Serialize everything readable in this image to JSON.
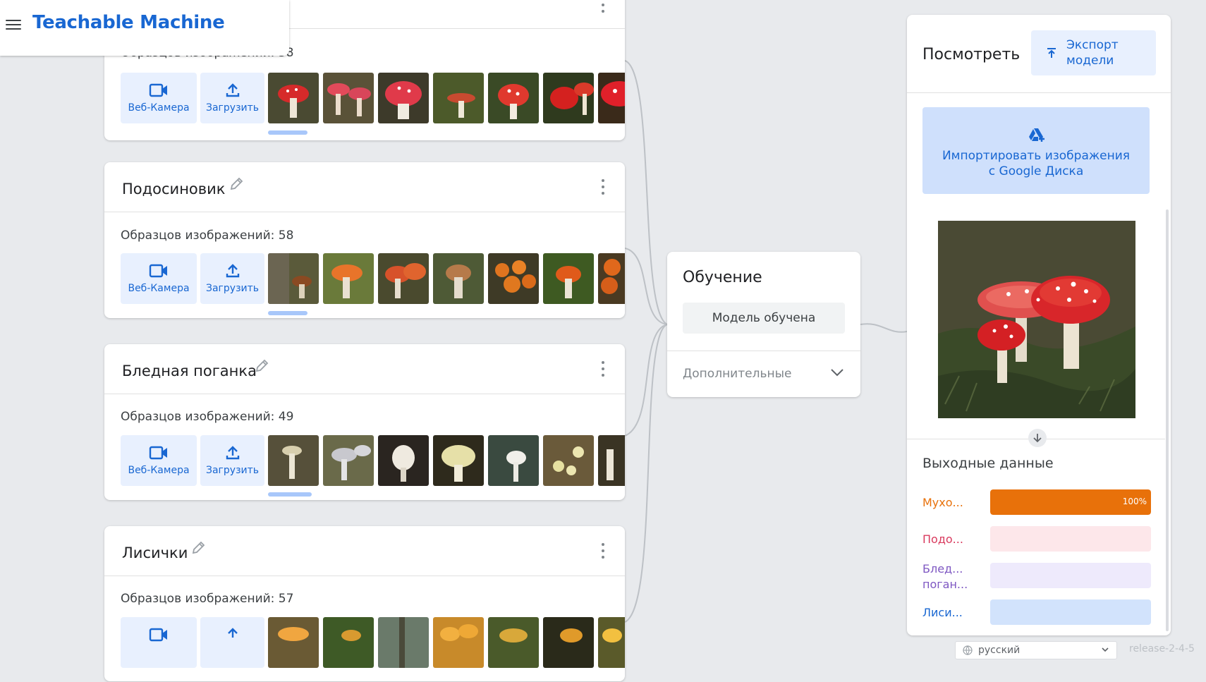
{
  "app": {
    "title": "Teachable Machine",
    "menu_icon": "hamburger-menu-icon"
  },
  "classes": [
    {
      "name": "",
      "samples_label": "Образцов изображений: 58",
      "webcam_label": "Веб-Камера",
      "upload_label": "Загрузить",
      "accent": "#d93025"
    },
    {
      "name": "Подосиновик",
      "samples_label": "Образцов изображений: 58",
      "webcam_label": "Веб-Камера",
      "upload_label": "Загрузить",
      "accent": "#e8710a"
    },
    {
      "name": "Бледная поганка",
      "samples_label": "Образцов изображений: 49",
      "webcam_label": "Веб-Камера",
      "upload_label": "Загрузить",
      "accent": "#c7c29a"
    },
    {
      "name": "Лисички",
      "samples_label": "Образцов изображений: 57",
      "webcam_label": "Веб-Камера",
      "upload_label": "Загрузить",
      "accent": "#f9ab00"
    }
  ],
  "training": {
    "title": "Обучение",
    "button_label": "Модель обучена",
    "advanced_label": "Дополнительные"
  },
  "preview": {
    "title": "Посмотреть",
    "export_label_line1": "Экспорт",
    "export_label_line2": "модели",
    "import_line1": "Импортировать изображения",
    "import_line2": "с Google Диска",
    "output_title": "Выходные данные",
    "outputs": [
      {
        "label": "Мухо...",
        "value": 1.0,
        "percent_text": "100%",
        "color": "#e8710a",
        "track": "#fce8d6"
      },
      {
        "label": "Подо...",
        "value": 0.0,
        "percent_text": "",
        "color": "#d93a5e",
        "track": "#fde7ea"
      },
      {
        "label": "Блед... поган...",
        "value": 0.0,
        "percent_text": "",
        "color": "#7e57c2",
        "track": "#eeeafc"
      },
      {
        "label": "Лиси...",
        "value": 0.0,
        "percent_text": "",
        "color": "#1967d2",
        "track": "#d2e3fc"
      }
    ]
  },
  "footer": {
    "language": "русский",
    "release": "release-2-4-5"
  }
}
